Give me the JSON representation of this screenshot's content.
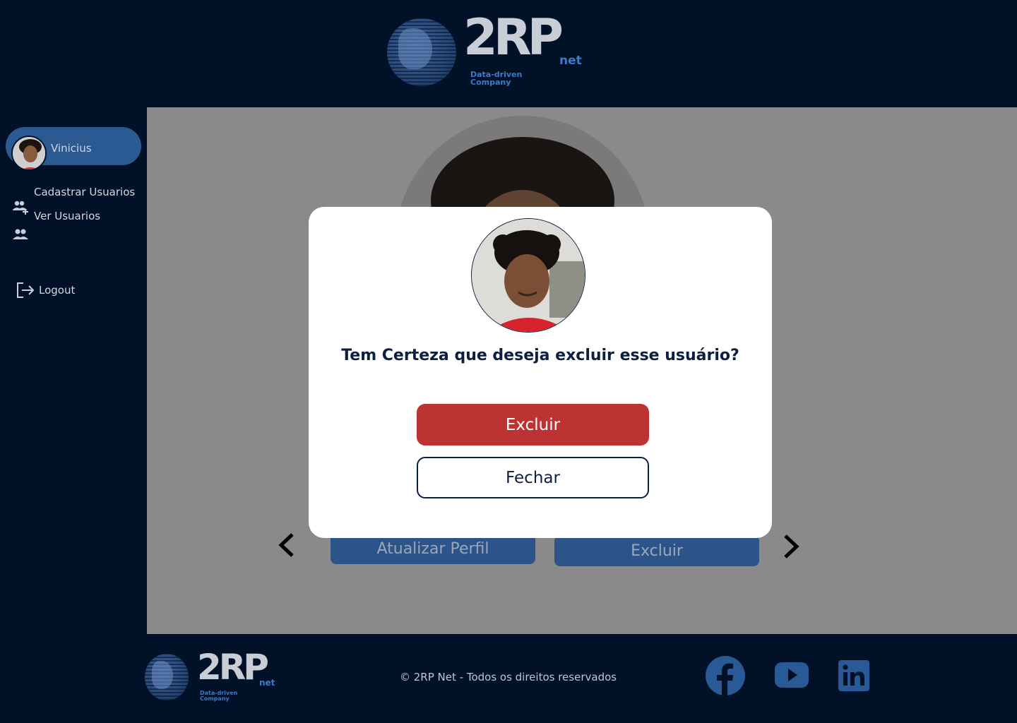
{
  "header": {
    "logo": {
      "text": "2RP",
      "suffix": "net",
      "tagline_line1": "Data-driven",
      "tagline_line2": "Company"
    }
  },
  "sidebar": {
    "user": {
      "name": "Vinicius"
    },
    "items": [
      {
        "label": "Cadastrar Usuarios",
        "icon": "add-group-icon"
      },
      {
        "label": "Ver Usuarios",
        "icon": "group-icon"
      }
    ],
    "logout": {
      "label": "Logout",
      "icon": "logout-icon"
    }
  },
  "background_card": {
    "update_button": "Atualizar Perfil",
    "delete_button": "Excluir"
  },
  "modal": {
    "question": "Tem Certeza que deseja excluir esse usuário?",
    "confirm_button": "Excluir",
    "close_button": "Fechar"
  },
  "footer": {
    "logo": {
      "text": "2RP",
      "suffix": "net",
      "tagline_line1": "Data-driven",
      "tagline_line2": "Company"
    },
    "copyright": "© 2RP Net - Todos os direitos reservados",
    "social": [
      "facebook-icon",
      "youtube-icon",
      "linkedin-icon"
    ]
  },
  "colors": {
    "background": "#001128",
    "accent": "#2b5a92",
    "danger": "#bd3333",
    "overlay_gray": "#8a8a8a",
    "icon_blue": "#2a5a96"
  }
}
